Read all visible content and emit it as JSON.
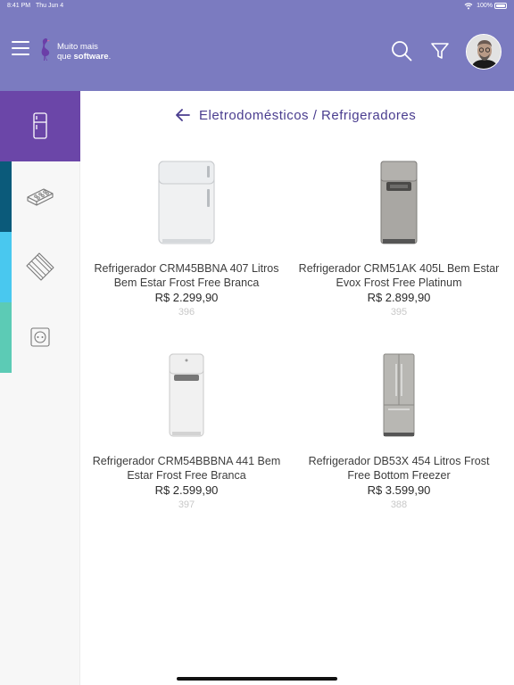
{
  "status_bar": {
    "time": "8:41 PM",
    "date": "Thu Jun 4",
    "battery": "100%"
  },
  "header": {
    "logo_line1": "Muito mais",
    "logo_line2_prefix": "que ",
    "logo_line2_bold": "software",
    "logo_line2_suffix": ".",
    "brand_color": "#7b7bc0",
    "icons": [
      "menu-icon",
      "search-icon",
      "filter-icon"
    ]
  },
  "sidebar": {
    "items": [
      {
        "name": "refrigerator",
        "icon": "refrigerator-icon",
        "active": true,
        "color": "#6b46a8"
      },
      {
        "name": "bricks",
        "icon": "brick-icon",
        "active": false,
        "color": "#0b5a7a"
      },
      {
        "name": "tiles",
        "icon": "tile-icon",
        "active": false,
        "color": "#49c8ef"
      },
      {
        "name": "outlet",
        "icon": "outlet-icon",
        "active": false,
        "color": "#5ccbb5"
      }
    ]
  },
  "breadcrumb": {
    "text": "Eletrodomésticos / Refrigeradores"
  },
  "products": [
    {
      "name": "Refrigerador CRM45BBNA 407 Litros Bem Estar Frost Free Branca",
      "price": "R$ 2.299,90",
      "code": "396",
      "finish": "white"
    },
    {
      "name": "Refrigerador CRM51AK 405L Bem Estar Evox Frost Free Platinum",
      "price": "R$ 2.899,90",
      "code": "395",
      "finish": "platinum"
    },
    {
      "name": "Refrigerador CRM54BBBNA 441 Bem Estar Frost Free Branca",
      "price": "R$ 2.599,90",
      "code": "397",
      "finish": "white"
    },
    {
      "name": "Refrigerador DB53X 454 Litros Frost Free Bottom Freezer",
      "price": "R$ 3.599,90",
      "code": "388",
      "finish": "steel"
    }
  ]
}
